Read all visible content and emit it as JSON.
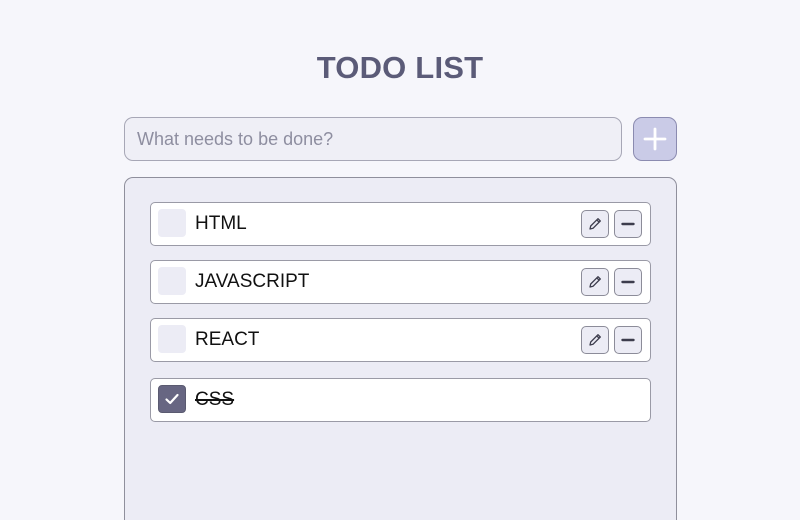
{
  "header": {
    "title": "TODO LIST"
  },
  "new_todo": {
    "placeholder": "What needs to be done?",
    "value": "",
    "add_icon": "plus-icon"
  },
  "todos": [
    {
      "label": "HTML",
      "completed": false,
      "edit_icon": "pencil-icon",
      "delete_icon": "minus-icon"
    },
    {
      "label": "JAVASCRIPT",
      "completed": false,
      "edit_icon": "pencil-icon",
      "delete_icon": "minus-icon"
    },
    {
      "label": "REACT",
      "completed": false,
      "edit_icon": "pencil-icon",
      "delete_icon": "minus-icon"
    },
    {
      "label": "CSS",
      "completed": true,
      "check_icon": "checkmark-icon"
    }
  ],
  "colors": {
    "background": "#f6f6fb",
    "title": "#5b5b78",
    "accent_button": "#cacbe7",
    "panel": "#ececf5",
    "checked_box": "#676682"
  }
}
